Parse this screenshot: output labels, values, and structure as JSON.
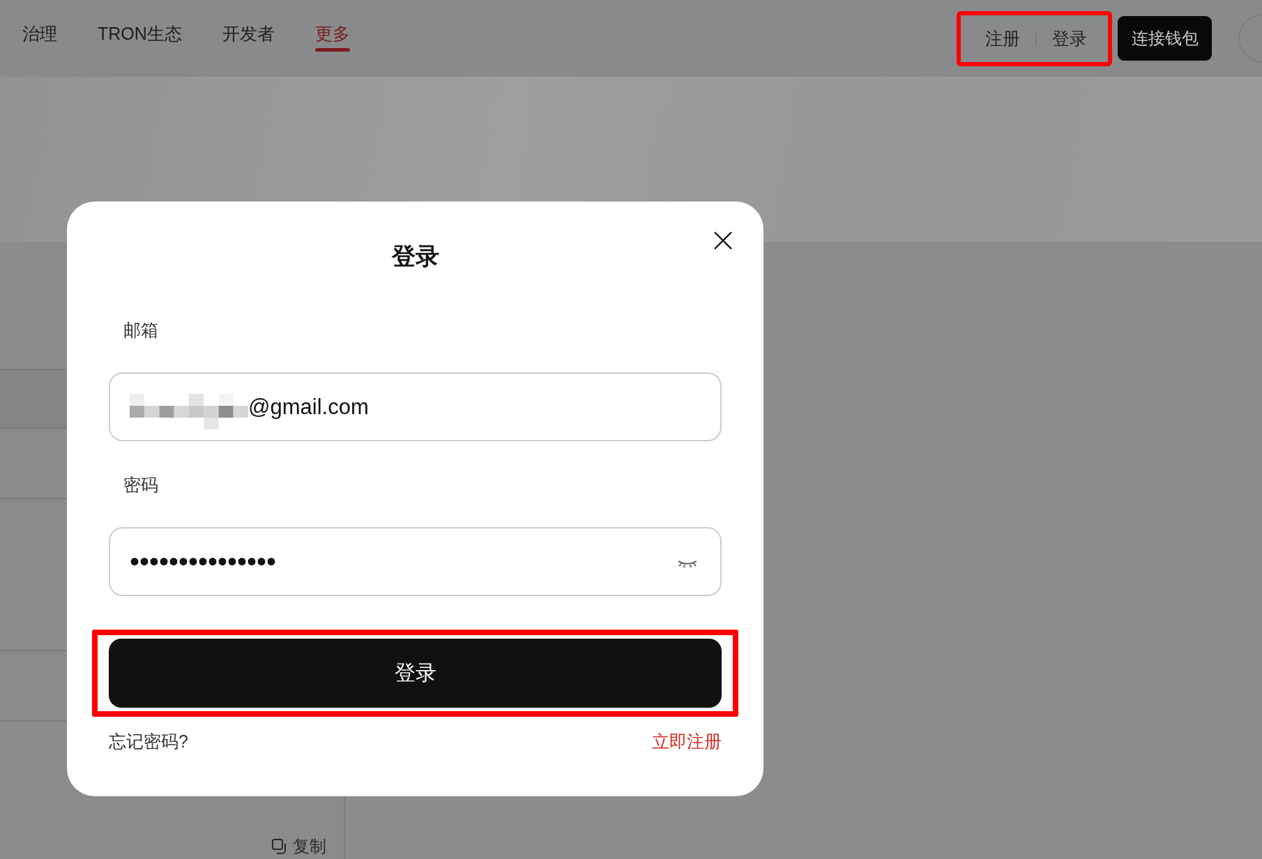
{
  "nav": {
    "items": [
      {
        "label": "治理",
        "selected": false
      },
      {
        "label": "TRON生态",
        "selected": false
      },
      {
        "label": "开发者",
        "selected": false
      },
      {
        "label": "更多",
        "selected": true
      }
    ],
    "auth": {
      "links": [
        "注册",
        "登录"
      ],
      "highlighted": true
    },
    "connect_button": "连接钱包"
  },
  "background": {
    "copy_link": "复制"
  },
  "modal": {
    "title": "登录",
    "email": {
      "label": "邮箱",
      "value": "@gmail.com",
      "redacted": true
    },
    "password": {
      "label": "密码",
      "value": "•••••••••••••••",
      "masked": true
    },
    "submit": {
      "label": "登录",
      "highlighted": true
    },
    "forgot": "忘记密码?",
    "register": "立即注册"
  }
}
